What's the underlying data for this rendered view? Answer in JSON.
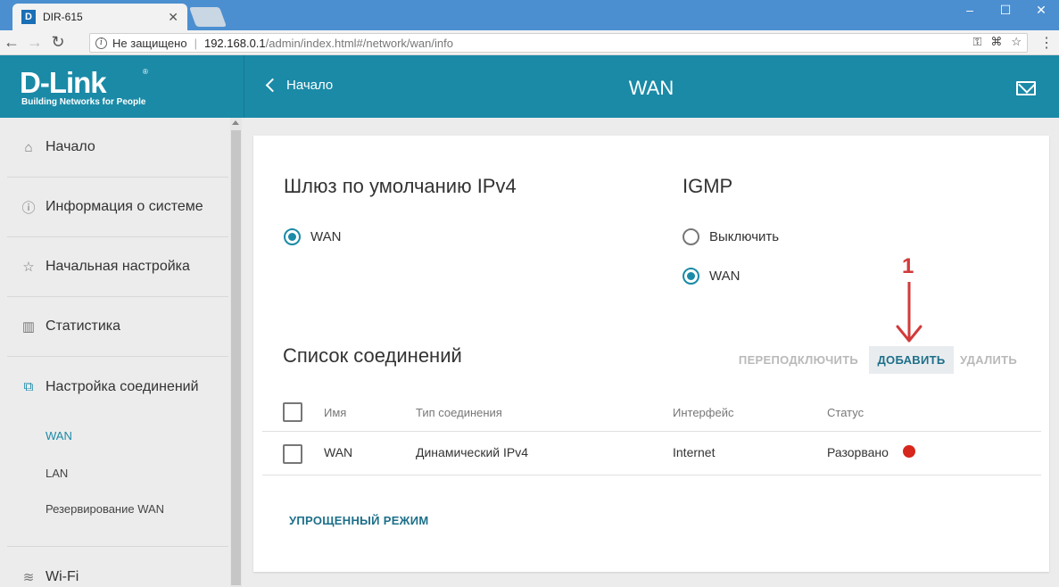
{
  "browser": {
    "tab_title": "DIR-615",
    "tab_favicon": "D",
    "security_label": "Не защищено",
    "url_host": "192.168.0.1",
    "url_path": "/admin/index.html#/network/wan/info"
  },
  "header": {
    "logo_text": "D-Link",
    "logo_tagline": "Building Networks for People",
    "back_label": "Начало",
    "title": "WAN"
  },
  "sidebar": {
    "items": [
      {
        "label": "Начало",
        "icon": "home-icon",
        "glyph": "⌂"
      },
      {
        "label": "Информация о системе",
        "icon": "info-icon",
        "glyph": "ⓘ"
      },
      {
        "label": "Начальная настройка",
        "icon": "star-icon",
        "glyph": "☆"
      },
      {
        "label": "Статистика",
        "icon": "stats-icon",
        "glyph": "▥"
      },
      {
        "label": "Настройка соединений",
        "icon": "connections-icon",
        "glyph": "⧉"
      }
    ],
    "subitems": [
      "WAN",
      "LAN",
      "Резервирование WAN"
    ],
    "wifi_label": "Wi-Fi"
  },
  "main": {
    "gateway_title": "Шлюз по умолчанию IPv4",
    "gateway_option": "WAN",
    "igmp_title": "IGMP",
    "igmp_options": [
      "Выключить",
      "WAN"
    ],
    "connections_title": "Список соединений",
    "actions": {
      "reconnect": "ПЕРЕПОДКЛЮЧИТЬ",
      "add": "ДОБАВИТЬ",
      "delete": "УДАЛИТЬ"
    },
    "table": {
      "headers": {
        "name": "Имя",
        "type": "Тип соединения",
        "interface": "Интерфейс",
        "status": "Статус"
      },
      "rows": [
        {
          "name": "WAN",
          "type": "Динамический IPv4",
          "interface": "Internet",
          "status": "Разорвано"
        }
      ]
    },
    "simple_mode": "УПРОЩЕННЫЙ РЕЖИМ"
  },
  "annotation": {
    "number": "1"
  },
  "colors": {
    "accent": "#1a8aa7",
    "status_disconnected": "#d7261b",
    "annotation": "#d23a3a"
  }
}
